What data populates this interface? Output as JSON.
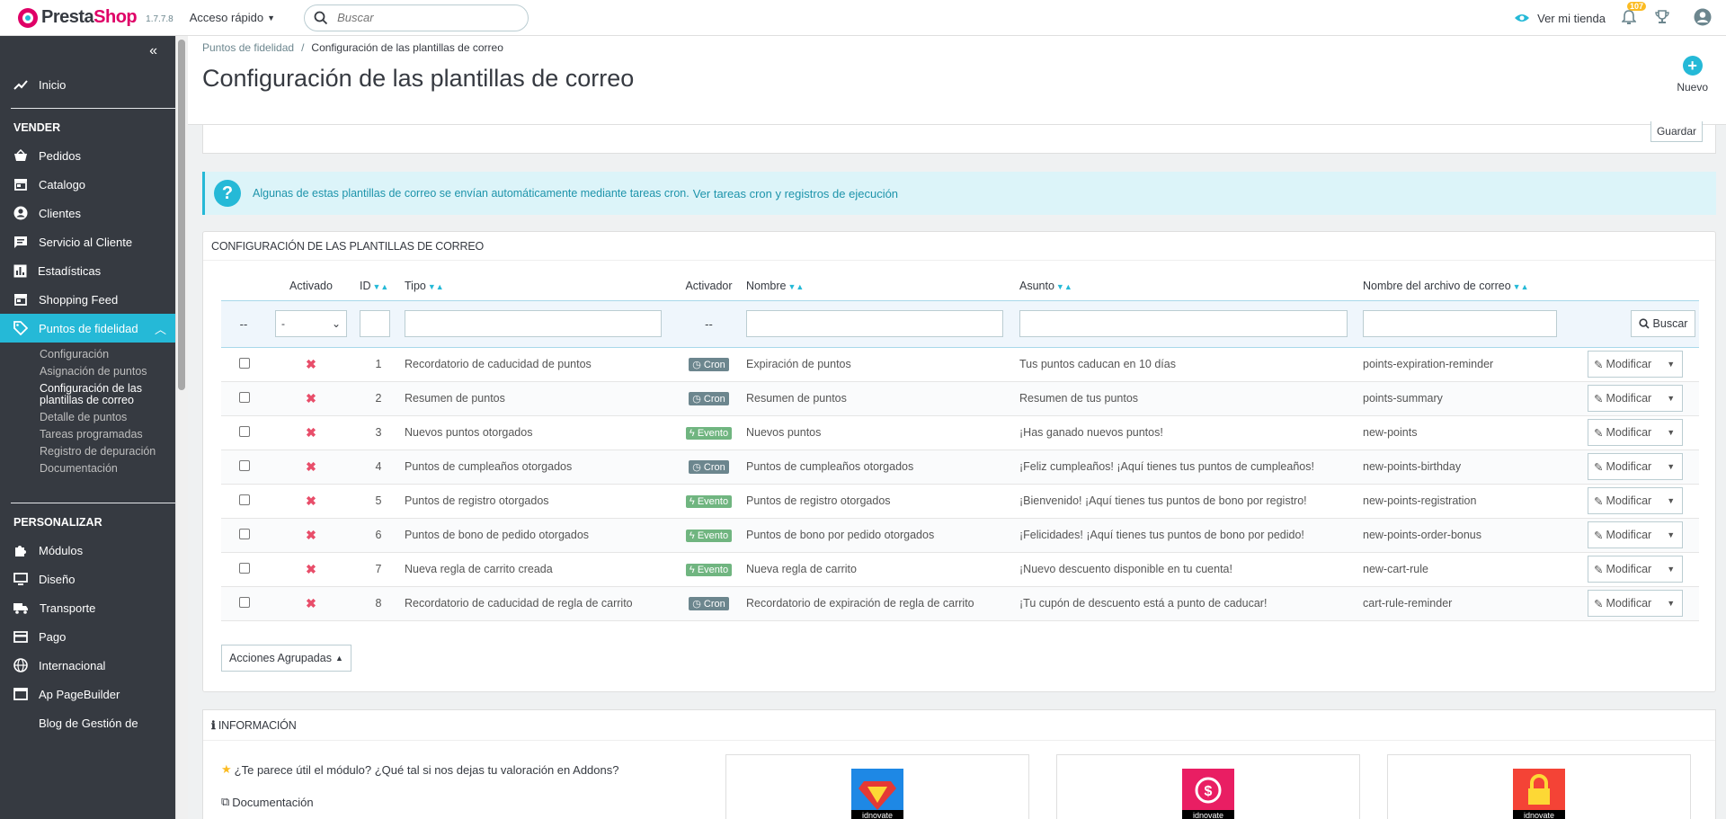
{
  "header": {
    "logo_prefix": "Presta",
    "logo_suffix": "Shop",
    "version": "1.7.7.8",
    "quick_access": "Acceso rápido",
    "search_placeholder": "Buscar",
    "view_store": "Ver mi tienda",
    "notifications_count": "107"
  },
  "sidebar": {
    "home": "Inicio",
    "sell_title": "VENDER",
    "sell_items": [
      "Pedidos",
      "Catalogo",
      "Clientes",
      "Servicio al Cliente",
      "Estadísticas",
      "Shopping Feed",
      "Puntos de fidelidad"
    ],
    "submenu": [
      "Configuración",
      "Asignación de puntos",
      "Configuración de las plantillas de correo",
      "Detalle de puntos",
      "Tareas programadas",
      "Registro de depuración",
      "Documentación"
    ],
    "personalize_title": "PERSONALIZAR",
    "personalize_items": [
      "Módulos",
      "Diseño",
      "Transporte",
      "Pago",
      "Internacional",
      "Ap PageBuilder",
      "Blog de Gestión de"
    ]
  },
  "page": {
    "breadcrumb_parent": "Puntos de fidelidad",
    "breadcrumb_current": "Configuración de las plantillas de correo",
    "title": "Configuración de las plantillas de correo",
    "new_label": "Nuevo",
    "save_label": "Guardar"
  },
  "alert": {
    "text": "Algunas de estas plantillas de correo se envían automáticamente mediante tareas cron.",
    "link": "Ver tareas cron y registros de ejecución"
  },
  "list": {
    "panel_title": "CONFIGURACIÓN DE LAS PLANTILLAS DE CORREO",
    "columns": {
      "activated": "Activado",
      "id": "ID",
      "type": "Tipo",
      "trigger": "Activador",
      "name": "Nombre",
      "subject": "Asunto",
      "filename": "Nombre del archivo de correo"
    },
    "filter": {
      "dash1": "--",
      "select_value": "-",
      "dash2": "--",
      "search_button": "Buscar"
    },
    "edit_label": "Modificar",
    "bulk_label": "Acciones Agrupadas",
    "rows": [
      {
        "id": "1",
        "type": "Recordatorio de caducidad de puntos",
        "trigger": "Cron",
        "name": "Expiración de puntos",
        "subject": "Tus puntos caducan en 10 días",
        "file": "points-expiration-reminder"
      },
      {
        "id": "2",
        "type": "Resumen de puntos",
        "trigger": "Cron",
        "name": "Resumen de puntos",
        "subject": "Resumen de tus puntos",
        "file": "points-summary"
      },
      {
        "id": "3",
        "type": "Nuevos puntos otorgados",
        "trigger": "Evento",
        "name": "Nuevos puntos",
        "subject": "¡Has ganado nuevos puntos!",
        "file": "new-points"
      },
      {
        "id": "4",
        "type": "Puntos de cumpleaños otorgados",
        "trigger": "Cron",
        "name": "Puntos de cumpleaños otorgados",
        "subject": "¡Feliz cumpleaños! ¡Aquí tienes tus puntos de cumpleaños!",
        "file": "new-points-birthday"
      },
      {
        "id": "5",
        "type": "Puntos de registro otorgados",
        "trigger": "Evento",
        "name": "Puntos de registro otorgados",
        "subject": "¡Bienvenido! ¡Aquí tienes tus puntos de bono por registro!",
        "file": "new-points-registration"
      },
      {
        "id": "6",
        "type": "Puntos de bono de pedido otorgados",
        "trigger": "Evento",
        "name": "Puntos de bono por pedido otorgados",
        "subject": "¡Felicidades! ¡Aquí tienes tus puntos de bono por pedido!",
        "file": "new-points-order-bonus"
      },
      {
        "id": "7",
        "type": "Nueva regla de carrito creada",
        "trigger": "Evento",
        "name": "Nueva regla de carrito",
        "subject": "¡Nuevo descuento disponible en tu cuenta!",
        "file": "new-cart-rule"
      },
      {
        "id": "8",
        "type": "Recordatorio de caducidad de regla de carrito",
        "trigger": "Cron",
        "name": "Recordatorio de expiración de regla de carrito",
        "subject": "¡Tu cupón de descuento está a punto de caducar!",
        "file": "cart-rule-reminder"
      }
    ]
  },
  "info": {
    "title": "INFORMACIÓN",
    "rate_text": "¿Te parece útil el módulo? ¿Qué tal si nos dejas tu valoración en Addons?",
    "doc_text": "Documentación",
    "brand": "idnovate"
  },
  "colors": {
    "accent": "#25b9d7",
    "sidebar": "#363a41",
    "cron_badge": "#6c868e",
    "event_badge": "#70b580",
    "disabled_x": "#e84e6a"
  }
}
